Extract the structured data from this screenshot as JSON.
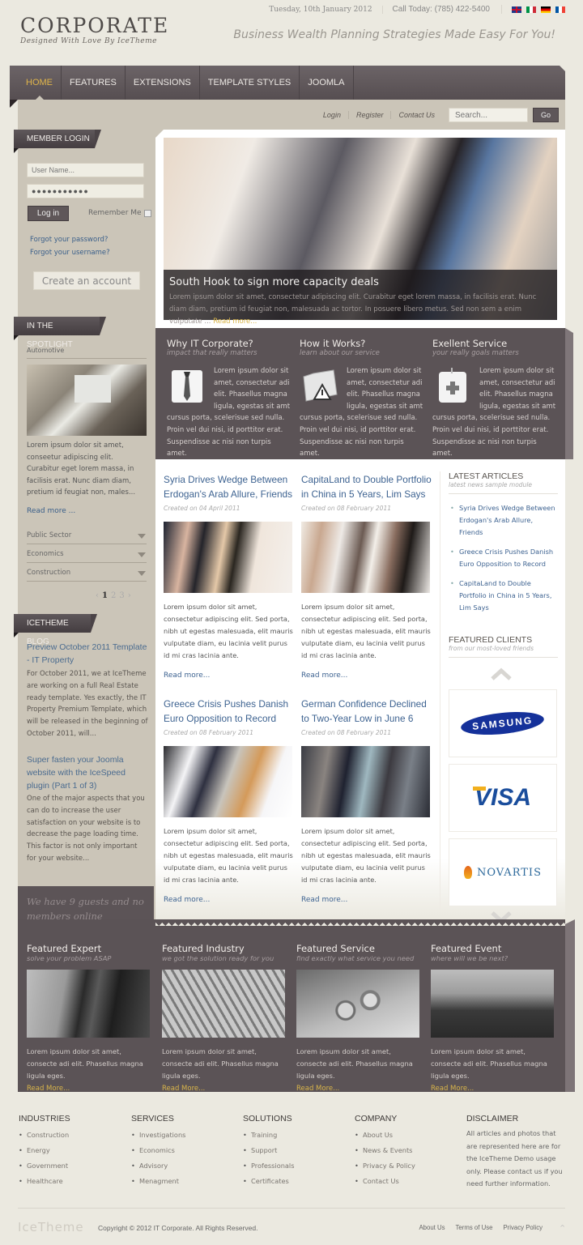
{
  "header": {
    "logo_title": "CORPORATE",
    "logo_tagline": "Designed With Love By IceTheme",
    "date": "Tuesday, 10th January 2012",
    "phone": "Call Today: (785) 422-5400",
    "slogan": "Business Wealth Planning Strategies Made Easy For You!",
    "languages": [
      "English",
      "Italian",
      "German",
      "French"
    ]
  },
  "nav": {
    "items": [
      {
        "label": "HOME",
        "active": true
      },
      {
        "label": "FEATURES",
        "active": false
      },
      {
        "label": "EXTENSIONS",
        "active": false
      },
      {
        "label": "TEMPLATE STYLES",
        "active": false
      },
      {
        "label": "JOOMLA",
        "active": false
      }
    ]
  },
  "subbar": {
    "login": "Login",
    "register": "Register",
    "contact": "Contact Us",
    "search_placeholder": "Search...",
    "go": "Go"
  },
  "login": {
    "title": "MEMBER LOGIN",
    "username_placeholder": "User Name...",
    "password_value": "●●●●●●●●●●●",
    "login_btn": "Log in",
    "remember": "Remember Me",
    "forgot_password": "Forgot your password?",
    "forgot_username": "Forgot your username?",
    "create_account": "Create an account"
  },
  "spotlight": {
    "title": "IN THE SPOTLIGHT",
    "category": "Automotive",
    "text": "Lorem ipsum dolor sit amet, conseetur adipiscing elit. Curabitur eget lorem massa, in facilisis erat. Nunc diam diam, pretium id feugiat non, males...",
    "read_more": "Read more ...",
    "accordion": [
      "Public Sector",
      "Economics",
      "Construction"
    ],
    "pager": {
      "prev": "‹",
      "pages": [
        "1",
        "2",
        "3"
      ],
      "current": "1",
      "next": "›"
    }
  },
  "blog": {
    "title": "ICETHEME BLOG",
    "posts": [
      {
        "title": "Preview October 2011 Template - IT Property",
        "text": "For October 2011, we at IceTheme are working on a full Real Estate ready template. Yes exactly, the IT Property Premium Template, which will be released in the beginning of October 2011,  will..."
      },
      {
        "title": "Super fasten your Joomla website with the IceSpeed plugin (Part 1 of 3)",
        "text": "One of the major aspects that you can do to increase the user satisfaction on your website is to decrease the page loading time. This factor is not only important for your website..."
      }
    ]
  },
  "online": "We have 9 guests and no members online",
  "slideshow": {
    "title": "South Hook to sign more capacity deals",
    "text": "Lorem ipsum dolor sit amet, consectetur adipiscing elit. Curabitur eget lorem massa, in facilisis erat. Nunc diam diam, pretium id feugiat non, malesuada ac tortor. In posuere libero metus. Sed non sem a enim vulputate ... ",
    "read_more": "Read more..."
  },
  "features": [
    {
      "title": "Why IT Corporate?",
      "subtitle": "impact that really matters",
      "icon": "shirt-tie-icon",
      "text": "Lorem ipsum dolor sit amet, consectetur adi elit. Phasellus magna ligula, egestas sit amt cursus porta, scelerisue sed nulla. Proin vel dui nisi, id porttitor erat. Suspendisse ac nisi non turpis amet."
    },
    {
      "title": "How it Works?",
      "subtitle": "learn about our service",
      "icon": "folder-warning-icon",
      "text": "Lorem ipsum dolor sit amet, consectetur adi elit. Phasellus magna ligula, egestas sit amt cursus porta, scelerisue sed nulla. Proin vel dui nisi, id porttitor erat. Suspendisse ac nisi non turpis amet."
    },
    {
      "title": "Exellent Service",
      "subtitle": "your really goals matters",
      "icon": "first-aid-kit-icon",
      "text": "Lorem ipsum dolor sit amet, consectetur adi elit. Phasellus magna ligula, egestas sit amt cursus porta, scelerisue sed nulla. Proin vel dui nisi, id porttitor erat. Suspendisse ac nisi non turpis amet."
    }
  ],
  "articles": [
    {
      "title": "Syria Drives Wedge Between Erdogan's Arab Allure, Friends",
      "date": "Created on 04 April 2011",
      "text": "Lorem ipsum dolor sit amet, consectetur adipiscing elit. Sed porta, nibh ut egestas malesuada, elit mauris vulputate diam, eu lacinia velit purus id mi cras lacinia ante.",
      "read_more": "Read more..."
    },
    {
      "title": "CapitaLand to Double Portfolio in China in 5 Years, Lim Says",
      "date": "Created on 08 February 2011",
      "text": "Lorem ipsum dolor sit amet, consectetur adipiscing elit. Sed porta, nibh ut egestas malesuada, elit mauris vulputate diam, eu lacinia velit purus id mi cras lacinia ante.",
      "read_more": "Read more..."
    },
    {
      "title": "Greece Crisis Pushes Danish Euro Opposition to Record",
      "date": "Created on 08 February 2011",
      "text": "Lorem ipsum dolor sit amet, consectetur adipiscing elit. Sed porta, nibh ut egestas malesuada, elit mauris vulputate diam, eu lacinia velit purus id mi cras lacinia ante.",
      "read_more": "Read more..."
    },
    {
      "title": "German Confidence Declined to Two-Year Low in June 6",
      "date": "Created on 08 February 2011",
      "text": "Lorem ipsum dolor sit amet, consectetur adipiscing elit. Sed porta, nibh ut egestas malesuada, elit mauris vulputate diam, eu lacinia velit purus id mi cras lacinia ante.",
      "read_more": "Read more..."
    }
  ],
  "latest": {
    "title": "LATEST ARTICLES",
    "subtitle": "latest news sample module",
    "items": [
      "Syria Drives Wedge Between Erdogan's Arab Allure, Friends",
      "Greece Crisis Pushes Danish Euro Opposition to Record",
      "CapitaLand to Double Portfolio in China in 5 Years, Lim Says"
    ]
  },
  "clients": {
    "title": "FEATURED CLIENTS",
    "subtitle": "from our most-loved friends",
    "logos": [
      "SAMSUNG",
      "VISA",
      "NOVARTIS"
    ]
  },
  "featured_band": [
    {
      "title": "Featured Expert",
      "subtitle": "solve your problem ASAP",
      "text": "Lorem ipsum dolor sit amet, consecte adi elit. Phasellus magna ligula eges.",
      "read_more": "Read More..."
    },
    {
      "title": "Featured Industry",
      "subtitle": "we got the solution ready for you",
      "text": "Lorem ipsum dolor sit amet, consecte adi elit. Phasellus magna ligula eges.",
      "read_more": "Read More..."
    },
    {
      "title": "Featured Service",
      "subtitle": "find exactly what service you need",
      "text": "Lorem ipsum dolor sit amet, consecte adi elit. Phasellus magna ligula eges.",
      "read_more": "Read More..."
    },
    {
      "title": "Featured Event",
      "subtitle": "where will we be next?",
      "text": "Lorem ipsum dolor sit amet, consecte adi elit. Phasellus magna ligula eges.",
      "read_more": "Read More..."
    }
  ],
  "footer": {
    "columns": [
      {
        "title": "INDUSTRIES",
        "items": [
          "Construction",
          "Energy",
          "Government",
          "Healthcare"
        ]
      },
      {
        "title": "SERVICES",
        "items": [
          "Investigations",
          "Economics",
          "Advisory",
          "Menagment"
        ]
      },
      {
        "title": "SOLUTIONS",
        "items": [
          "Training",
          "Support",
          "Professionals",
          "Certificates"
        ]
      },
      {
        "title": "COMPANY",
        "items": [
          "About Us",
          "News & Events",
          "Privacy & Policy",
          "Contact Us"
        ]
      }
    ],
    "disclaimer_title": "DISCLAIMER",
    "disclaimer_text": "All articles and photos that are represented here are for the IceTheme Demo usage only. Please contact us if you need further information.",
    "brand": "IceTheme",
    "copyright": "Copyright © 2012 IT Corporate. All Rights Reserved.",
    "links": [
      "About Us",
      "Terms of Use",
      "Privacy Policy"
    ],
    "back_to_top": "^"
  },
  "colors": {
    "accent_gold": "#e0b54a",
    "brand_dark": "#5b5356",
    "link_blue": "#3e6391",
    "panel_beige": "#cbc5b8",
    "page_bg": "#ebe9e0"
  }
}
